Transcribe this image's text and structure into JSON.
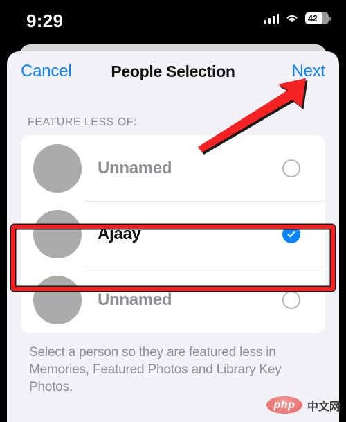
{
  "status_bar": {
    "time": "9:29",
    "battery_percent": "42",
    "cellular_icon": "cellular-signal-icon",
    "wifi_icon": "wifi-icon",
    "battery_icon": "battery-icon"
  },
  "nav": {
    "cancel_label": "Cancel",
    "title": "People Selection",
    "next_label": "Next"
  },
  "section": {
    "header": "FEATURE LESS OF:"
  },
  "people": [
    {
      "name": "Unnamed",
      "selected": false
    },
    {
      "name": "Ajaay",
      "selected": true
    },
    {
      "name": "Unnamed",
      "selected": false
    }
  ],
  "footer": {
    "text": "Select a person so they are featured less in Memories, Featured Photos and Library Key Photos."
  },
  "watermark": {
    "logo_text": "php",
    "suffix_text": "中文网"
  },
  "annotations": {
    "arrow": "red-arrow-pointing-to-next",
    "highlight": "red-box-around-selected-person"
  },
  "colors": {
    "accent_blue": "#0a84ff",
    "annotation_red": "#f42222",
    "avatar_gray": "#ababab",
    "sheet_bg": "#f2f1f6"
  }
}
